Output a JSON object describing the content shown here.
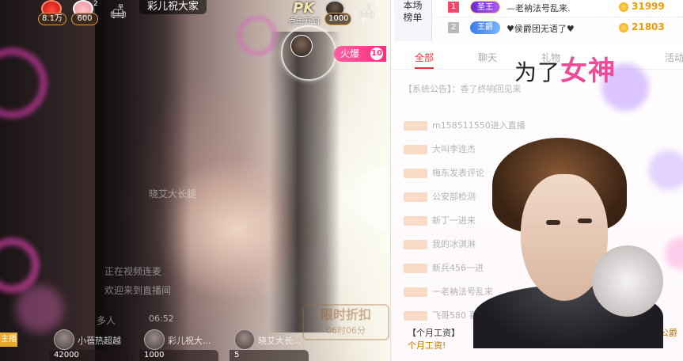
{
  "stage": {
    "title": "彩儿祝大家",
    "top_left": {
      "fans_count": "8.1万",
      "pig_count": "600",
      "pig_badge": "2"
    },
    "pk": {
      "label": "PK",
      "subtitle": "点击开启",
      "value": "1000",
      "sofa_badge": "2",
      "question": "?"
    },
    "fire": {
      "label": "火爆",
      "value": "10"
    },
    "faint_texts": {
      "viewer_name": "晓艾大长腿",
      "video_link": "正在视频连麦",
      "welcome": "欢迎来到直播间",
      "people": "多人",
      "limit_title": "限时折扣",
      "limit_time": "06时06分",
      "clock": "06:52"
    },
    "bottom_items": [
      {
        "name": "小蓓热超越",
        "value": "42000"
      },
      {
        "name": "彩儿祝大...",
        "value": "1000"
      },
      {
        "name": "晓艾大长...",
        "value": "5"
      }
    ],
    "tag_left": "主播"
  },
  "panel": {
    "rank_label_1": "本场",
    "rank_label_2": "榜单",
    "ranks": [
      {
        "no": "1",
        "badge": "圣王",
        "name": "—老衲法号乱来.",
        "score": "31999"
      },
      {
        "no": "2",
        "badge": "王爵",
        "name": "♥侯爵团无语了♥",
        "score": "21803"
      }
    ],
    "tabs": [
      "全部",
      "聊天",
      "礼物",
      "活动"
    ],
    "overlay": {
      "prefix": "为了",
      "highlight": "女神"
    },
    "chat_lines": [
      "【系统公告】：香了终响回见来",
      "m158511550进入直播",
      "大叫李连杰",
      "梅东发表评论",
      "公安部检测",
      "新丁一进来",
      "我的冰淇淋",
      "新兵456一进",
      "一老衲法号乱来",
      "飞哥580 喜欢主播"
    ],
    "footer_a": "【个月工资】",
    "footer_b": "个月工资!",
    "footer_c": "李昊哥升公爵"
  },
  "colors": {
    "accent_pink": "#ef4a9a",
    "rank1": "#f04a6a",
    "score": "#f09a00",
    "tab_active": "#e33333"
  }
}
